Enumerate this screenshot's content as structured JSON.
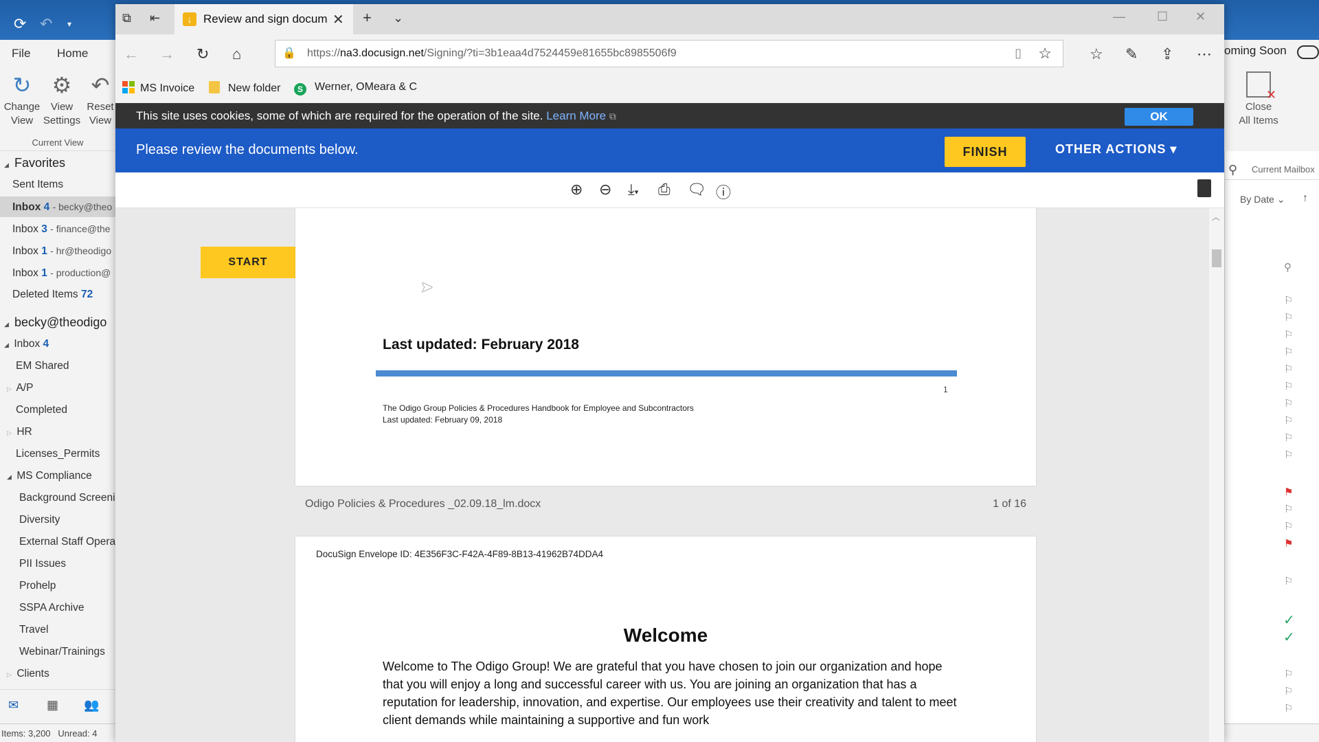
{
  "outlook": {
    "menu": {
      "file": "File",
      "home": "Home"
    },
    "ribbon": {
      "change_view_l1": "Change",
      "change_view_l2": "View",
      "view_settings_l1": "View",
      "view_settings_l2": "Settings",
      "reset_view_l1": "Reset",
      "reset_view_l2": "View",
      "group_label": "Current View"
    },
    "favorites_header": "Favorites",
    "favorites": [
      {
        "label": "Sent Items",
        "count": "",
        "account": ""
      },
      {
        "label": "Inbox",
        "count": "4",
        "account": "- becky@theo"
      },
      {
        "label": "Inbox",
        "count": "3",
        "account": "- finance@the"
      },
      {
        "label": "Inbox",
        "count": "1",
        "account": "- hr@theodigo"
      },
      {
        "label": "Inbox",
        "count": "1",
        "account": "- production@"
      },
      {
        "label": "Deleted Items",
        "count": "72",
        "account": ""
      }
    ],
    "account_header": "becky@theodigo",
    "inbox": {
      "label": "Inbox",
      "count": "4"
    },
    "folders": [
      "EM Shared",
      "A/P",
      "Completed",
      "HR",
      "Licenses_Permits"
    ],
    "ms_compliance": "MS Compliance",
    "subfolders": [
      "Background Screeni",
      "Diversity",
      "External Staff Opera",
      "PII Issues",
      "Prohelp",
      "SSPA Archive",
      "Travel",
      "Webinar/Trainings"
    ],
    "clients": "Clients",
    "status": {
      "items": "Items: 3,200",
      "unread": "Unread: 4"
    },
    "coming_soon": "oming Soon",
    "close_items_l1": "Close",
    "close_items_l2": "All Items",
    "search_placeholder": "Current Mailbox",
    "sort_label": "By Date"
  },
  "browser": {
    "tab_title": "Review and sign docum",
    "url_prefix": "https://",
    "url_host": "na3.docusign.net",
    "url_path": "/Signing/?ti=3b1eaa4d7524459e81655bc8985506f9",
    "favorites": [
      "MS Invoice",
      "New folder",
      "Werner, OMeara & C"
    ]
  },
  "docusign": {
    "cookie_message": "This site uses cookies, some of which are required for the operation of the site.",
    "learn_more": "Learn More",
    "ok": "OK",
    "review_message": "Please review the documents below.",
    "finish": "FINISH",
    "other_actions": "OTHER ACTIONS ▾",
    "start": "START",
    "page1": {
      "last_updated": "Last updated: February 2018",
      "page_number": "1",
      "footer_line1": "The Odigo Group Policies & Procedures Handbook for Employee and Subcontractors",
      "footer_line2": "Last updated: February 09, 2018"
    },
    "document_name": "Odigo Policies & Procedures _02.09.18_lm.docx",
    "page_count": "1 of 16",
    "page2": {
      "envelope_id": "DocuSign Envelope ID: 4E356F3C-F42A-4F89-8B13-41962B74DDA4",
      "heading": "Welcome",
      "body": "Welcome to The Odigo Group! We are grateful that you have chosen to join our organization and hope that you will enjoy a long and successful career with us. You are joining an organization that has a reputation for leadership, innovation, and expertise. Our employees use their creativity and talent to meet client demands while maintaining a supportive and fun work"
    }
  },
  "colors": {
    "docusign_blue": "#1d5bc7",
    "docusign_yellow": "#ffc820",
    "cookie_bar": "#333333",
    "outlook_blue": "#2a6fbc"
  }
}
